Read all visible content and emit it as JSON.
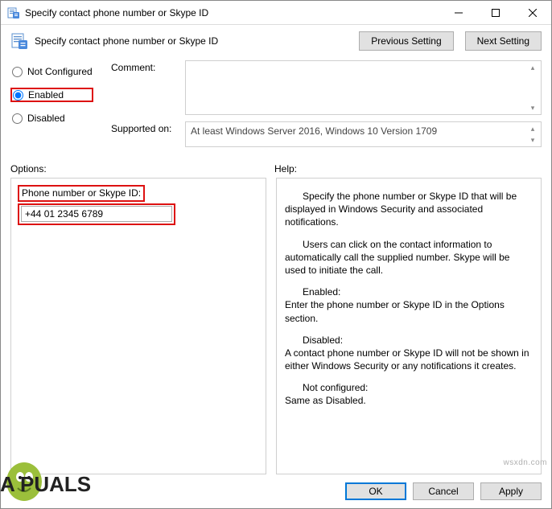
{
  "window": {
    "title": "Specify contact phone number or Skype ID",
    "subtitle": "Specify contact phone number or Skype ID"
  },
  "nav": {
    "prev": "Previous Setting",
    "next": "Next Setting"
  },
  "state": {
    "not_configured": "Not Configured",
    "enabled": "Enabled",
    "disabled": "Disabled",
    "selected": "enabled"
  },
  "fields": {
    "comment_label": "Comment:",
    "comment_value": "",
    "supported_label": "Supported on:",
    "supported_value": "At least Windows Server 2016, Windows 10 Version 1709"
  },
  "panes": {
    "options_header": "Options:",
    "help_header": "Help:"
  },
  "options": {
    "field_label": "Phone number or Skype ID:",
    "field_value": "+44 01 2345 6789"
  },
  "help": {
    "p1": "Specify the phone number or Skype ID that will be displayed in Windows Security and associated notifications.",
    "p2": "Users can click on the contact information to automatically call the supplied number. Skype will be used to initiate the call.",
    "p3a": "Enabled:",
    "p3b": "Enter the phone number or Skype ID in the Options section.",
    "p4a": "Disabled:",
    "p4b": "A contact phone number or Skype ID will not be shown in either Windows Security or any notifications it creates.",
    "p5a": "Not configured:",
    "p5b": "Same as Disabled."
  },
  "buttons": {
    "ok": "OK",
    "cancel": "Cancel",
    "apply": "Apply"
  },
  "watermark": {
    "brand": "A   PUALS",
    "site": "wsxdn.com"
  }
}
